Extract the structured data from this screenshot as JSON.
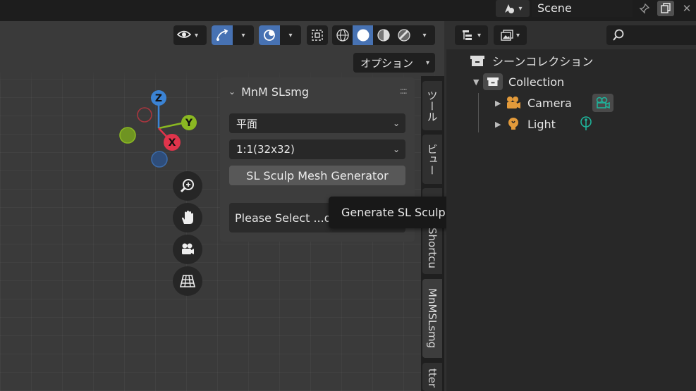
{
  "topbar": {
    "scene_label": "Scene"
  },
  "viewport": {
    "options_label": "オプション",
    "gizmo": {
      "z": "Z",
      "y": "Y",
      "x": "X"
    }
  },
  "sidebar_tabs": [
    {
      "label": "ツール"
    },
    {
      "label": "ビュー"
    },
    {
      "label": "Shortcu"
    },
    {
      "label": "MnMSLsmg"
    },
    {
      "label": "tter"
    }
  ],
  "panel": {
    "title": "MnM SLsmg",
    "shape_value": "平面",
    "size_value": "1:1(32x32)",
    "generate_button": "SL Sculp Mesh Generator",
    "status_text": "Please Select ...d"
  },
  "tooltip": {
    "text": "Generate SL Sculp Mesh object.."
  },
  "outliner": {
    "scene_collection": "シーンコレクション",
    "collection": "Collection",
    "items": [
      {
        "label": "Camera"
      },
      {
        "label": "Light"
      }
    ]
  },
  "colors": {
    "accent": "#4772b3",
    "axis_x": "#e0344b",
    "axis_y": "#8ab822",
    "axis_z": "#3b83d4",
    "camera_icon": "#e39a3a",
    "data_icon": "#1fb39a"
  }
}
